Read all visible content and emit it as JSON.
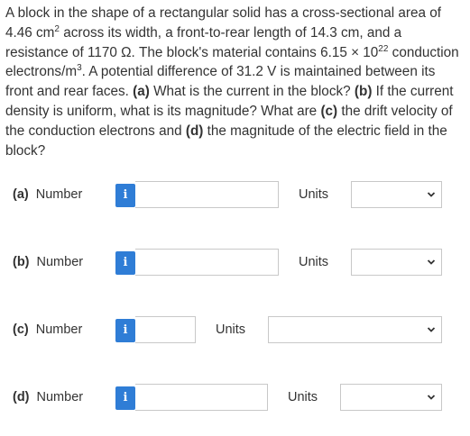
{
  "question": {
    "t1": "A block in the shape of a rectangular solid has a cross-sectional area of 4.46 cm",
    "s1": "2",
    "t2": " across its width, a front-to-rear length of 14.3 cm, and a resistance of 1170 Ω. The block's material contains 6.15 × 10",
    "s2": "22",
    "t3": " conduction electrons/m",
    "s3": "3",
    "t4": ". A potential difference of 31.2 V is maintained between its front and rear faces. ",
    "b1": "(a)",
    "t5": " What is the current in the block? ",
    "b2": "(b)",
    "t6": " If the current density is uniform, what is its magnitude? What are ",
    "b3": "(c)",
    "t7": " the drift velocity of the conduction electrons and ",
    "b4": "(d)",
    "t8": " the magnitude of the electric field in the block?"
  },
  "parts": [
    {
      "letter": "(a)",
      "label": "Number",
      "info": "i",
      "value": "",
      "units_label": "Units",
      "units_value": ""
    },
    {
      "letter": "(b)",
      "label": "Number",
      "info": "i",
      "value": "",
      "units_label": "Units",
      "units_value": ""
    },
    {
      "letter": "(c)",
      "label": "Number",
      "info": "i",
      "value": "",
      "units_label": "Units",
      "units_value": ""
    },
    {
      "letter": "(d)",
      "label": "Number",
      "info": "i",
      "value": "",
      "units_label": "Units",
      "units_value": ""
    }
  ],
  "colors": {
    "info_button": "#2f7dd6",
    "border": "#c8c8c8",
    "text": "#333333"
  },
  "icons": {
    "info": "info-icon",
    "dropdown": "chevron-down-icon"
  }
}
